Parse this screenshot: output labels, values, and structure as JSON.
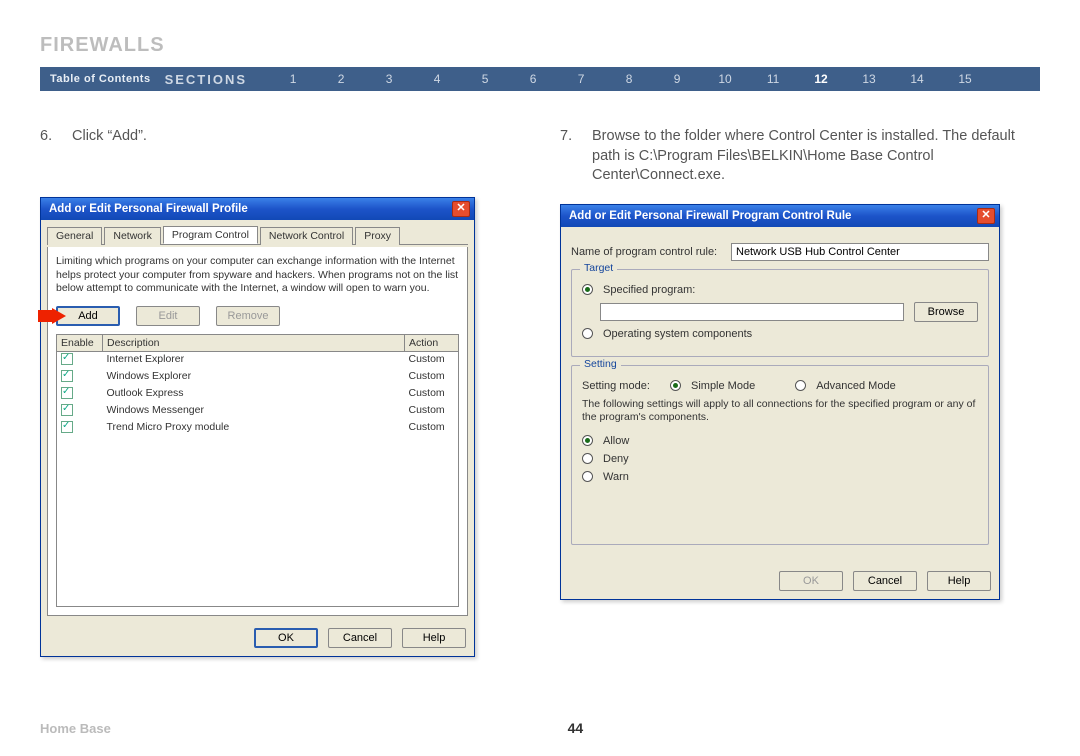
{
  "page_title": "FIREWALLS",
  "section_nav": {
    "toc_label": "Table of Contents",
    "sections_label": "SECTIONS",
    "numbers": [
      "1",
      "2",
      "3",
      "4",
      "5",
      "6",
      "7",
      "8",
      "9",
      "10",
      "11",
      "12",
      "13",
      "14",
      "15"
    ],
    "active": "12"
  },
  "step_left": {
    "num": "6.",
    "text": "Click “Add”."
  },
  "step_right": {
    "num": "7.",
    "text": "Browse to the folder where Control Center is installed. The default path is C:\\Program Files\\BELKIN\\Home Base Control Center\\Connect.exe."
  },
  "dialog_left": {
    "title": "Add or Edit Personal Firewall Profile",
    "tabs": [
      "General",
      "Network",
      "Program Control",
      "Network Control",
      "Proxy"
    ],
    "active_tab": "Program Control",
    "info": "Limiting which programs on your computer can exchange information with the Internet helps protect your computer from spyware and hackers. When programs not on the list below attempt to communicate with the Internet, a window will open to warn you.",
    "buttons": {
      "add": "Add",
      "edit": "Edit",
      "remove": "Remove"
    },
    "columns": {
      "enable": "Enable",
      "description": "Description",
      "action": "Action"
    },
    "rows": [
      {
        "enabled": true,
        "description": "Internet Explorer",
        "action": "Custom"
      },
      {
        "enabled": true,
        "description": "Windows Explorer",
        "action": "Custom"
      },
      {
        "enabled": true,
        "description": "Outlook Express",
        "action": "Custom"
      },
      {
        "enabled": true,
        "description": "Windows Messenger",
        "action": "Custom"
      },
      {
        "enabled": true,
        "description": "Trend Micro Proxy module",
        "action": "Custom"
      }
    ],
    "footer": {
      "ok": "OK",
      "cancel": "Cancel",
      "help": "Help"
    }
  },
  "dialog_right": {
    "title": "Add or Edit Personal Firewall Program Control Rule",
    "name_label": "Name of program control rule:",
    "name_value": "Network USB Hub Control Center",
    "target_legend": "Target",
    "opt_specified": "Specified program:",
    "browse_btn": "Browse",
    "opt_os": "Operating system components",
    "setting_legend": "Setting",
    "setting_mode_label": "Setting mode:",
    "mode_simple": "Simple Mode",
    "mode_advanced": "Advanced Mode",
    "setting_text": "The following settings will apply to all connections for the specified program or any of the program's components.",
    "opt_allow": "Allow",
    "opt_deny": "Deny",
    "opt_warn": "Warn",
    "footer": {
      "ok": "OK",
      "cancel": "Cancel",
      "help": "Help"
    }
  },
  "footer": {
    "doc_name": "Home Base",
    "page_number": "44"
  }
}
